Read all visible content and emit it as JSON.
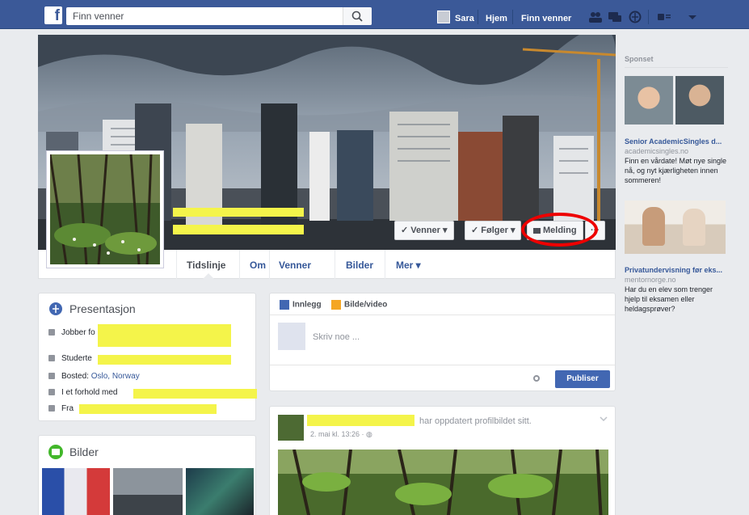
{
  "topbar": {
    "logo": "f",
    "search_placeholder": "Finn venner",
    "user_name": "Sara",
    "home": "Hjem",
    "find_friends": "Finn venner"
  },
  "profile": {
    "buttons": {
      "friends": "✓ Venner ▾",
      "following": "✓ Følger ▾",
      "message": "Melding",
      "more": "···"
    },
    "tabs": [
      "Tidslinje",
      "Om",
      "Venner",
      "Bilder",
      "Mer ▾"
    ]
  },
  "intro": {
    "title": "Presentasjon",
    "works_at": "Jobber fo",
    "studies": "Studerte",
    "lives_label": "Bosted:",
    "lives_value": "Oslo, Norway",
    "relationship": "I et forhold med",
    "from": "Fra"
  },
  "photos": {
    "title": "Bilder"
  },
  "composer": {
    "post_tab": "Innlegg",
    "photo_tab": "Bilde/video",
    "placeholder": "Skriv noe ...",
    "publish": "Publiser"
  },
  "post": {
    "action": "har oppdatert profilbildet sitt.",
    "meta": "2. mai kl. 13:26 · ◍"
  },
  "sidebar": {
    "sponsored": "Sponset",
    "ads": [
      {
        "title": "Senior AcademicSingles d...",
        "url": "academicsingles.no",
        "text": "Finn en vårdate! Møt nye single nå, og nyt kjærligheten innen sommeren!"
      },
      {
        "title": "Privatundervisning før eks...",
        "url": "mentornorge.no",
        "text": "Har du en elev som trenger hjelp til eksamen eller heldagsprøver?"
      }
    ]
  },
  "colors": {
    "brand": "#3b5998",
    "highlight_redaction": "#f4f44a",
    "annotation": "#e00000"
  }
}
